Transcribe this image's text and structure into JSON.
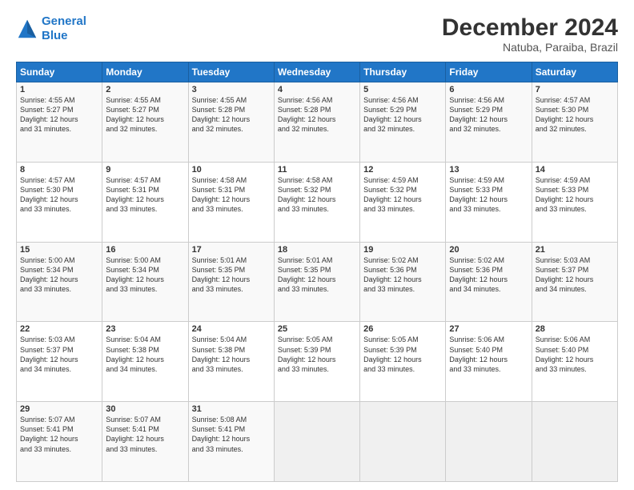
{
  "logo": {
    "line1": "General",
    "line2": "Blue"
  },
  "title": "December 2024",
  "location": "Natuba, Paraiba, Brazil",
  "columns": [
    "Sunday",
    "Monday",
    "Tuesday",
    "Wednesday",
    "Thursday",
    "Friday",
    "Saturday"
  ],
  "weeks": [
    [
      {
        "day": "1",
        "info": "Sunrise: 4:55 AM\nSunset: 5:27 PM\nDaylight: 12 hours\nand 31 minutes."
      },
      {
        "day": "2",
        "info": "Sunrise: 4:55 AM\nSunset: 5:27 PM\nDaylight: 12 hours\nand 32 minutes."
      },
      {
        "day": "3",
        "info": "Sunrise: 4:55 AM\nSunset: 5:28 PM\nDaylight: 12 hours\nand 32 minutes."
      },
      {
        "day": "4",
        "info": "Sunrise: 4:56 AM\nSunset: 5:28 PM\nDaylight: 12 hours\nand 32 minutes."
      },
      {
        "day": "5",
        "info": "Sunrise: 4:56 AM\nSunset: 5:29 PM\nDaylight: 12 hours\nand 32 minutes."
      },
      {
        "day": "6",
        "info": "Sunrise: 4:56 AM\nSunset: 5:29 PM\nDaylight: 12 hours\nand 32 minutes."
      },
      {
        "day": "7",
        "info": "Sunrise: 4:57 AM\nSunset: 5:30 PM\nDaylight: 12 hours\nand 32 minutes."
      }
    ],
    [
      {
        "day": "8",
        "info": "Sunrise: 4:57 AM\nSunset: 5:30 PM\nDaylight: 12 hours\nand 33 minutes."
      },
      {
        "day": "9",
        "info": "Sunrise: 4:57 AM\nSunset: 5:31 PM\nDaylight: 12 hours\nand 33 minutes."
      },
      {
        "day": "10",
        "info": "Sunrise: 4:58 AM\nSunset: 5:31 PM\nDaylight: 12 hours\nand 33 minutes."
      },
      {
        "day": "11",
        "info": "Sunrise: 4:58 AM\nSunset: 5:32 PM\nDaylight: 12 hours\nand 33 minutes."
      },
      {
        "day": "12",
        "info": "Sunrise: 4:59 AM\nSunset: 5:32 PM\nDaylight: 12 hours\nand 33 minutes."
      },
      {
        "day": "13",
        "info": "Sunrise: 4:59 AM\nSunset: 5:33 PM\nDaylight: 12 hours\nand 33 minutes."
      },
      {
        "day": "14",
        "info": "Sunrise: 4:59 AM\nSunset: 5:33 PM\nDaylight: 12 hours\nand 33 minutes."
      }
    ],
    [
      {
        "day": "15",
        "info": "Sunrise: 5:00 AM\nSunset: 5:34 PM\nDaylight: 12 hours\nand 33 minutes."
      },
      {
        "day": "16",
        "info": "Sunrise: 5:00 AM\nSunset: 5:34 PM\nDaylight: 12 hours\nand 33 minutes."
      },
      {
        "day": "17",
        "info": "Sunrise: 5:01 AM\nSunset: 5:35 PM\nDaylight: 12 hours\nand 33 minutes."
      },
      {
        "day": "18",
        "info": "Sunrise: 5:01 AM\nSunset: 5:35 PM\nDaylight: 12 hours\nand 33 minutes."
      },
      {
        "day": "19",
        "info": "Sunrise: 5:02 AM\nSunset: 5:36 PM\nDaylight: 12 hours\nand 33 minutes."
      },
      {
        "day": "20",
        "info": "Sunrise: 5:02 AM\nSunset: 5:36 PM\nDaylight: 12 hours\nand 34 minutes."
      },
      {
        "day": "21",
        "info": "Sunrise: 5:03 AM\nSunset: 5:37 PM\nDaylight: 12 hours\nand 34 minutes."
      }
    ],
    [
      {
        "day": "22",
        "info": "Sunrise: 5:03 AM\nSunset: 5:37 PM\nDaylight: 12 hours\nand 34 minutes."
      },
      {
        "day": "23",
        "info": "Sunrise: 5:04 AM\nSunset: 5:38 PM\nDaylight: 12 hours\nand 34 minutes."
      },
      {
        "day": "24",
        "info": "Sunrise: 5:04 AM\nSunset: 5:38 PM\nDaylight: 12 hours\nand 33 minutes."
      },
      {
        "day": "25",
        "info": "Sunrise: 5:05 AM\nSunset: 5:39 PM\nDaylight: 12 hours\nand 33 minutes."
      },
      {
        "day": "26",
        "info": "Sunrise: 5:05 AM\nSunset: 5:39 PM\nDaylight: 12 hours\nand 33 minutes."
      },
      {
        "day": "27",
        "info": "Sunrise: 5:06 AM\nSunset: 5:40 PM\nDaylight: 12 hours\nand 33 minutes."
      },
      {
        "day": "28",
        "info": "Sunrise: 5:06 AM\nSunset: 5:40 PM\nDaylight: 12 hours\nand 33 minutes."
      }
    ],
    [
      {
        "day": "29",
        "info": "Sunrise: 5:07 AM\nSunset: 5:41 PM\nDaylight: 12 hours\nand 33 minutes."
      },
      {
        "day": "30",
        "info": "Sunrise: 5:07 AM\nSunset: 5:41 PM\nDaylight: 12 hours\nand 33 minutes."
      },
      {
        "day": "31",
        "info": "Sunrise: 5:08 AM\nSunset: 5:41 PM\nDaylight: 12 hours\nand 33 minutes."
      },
      null,
      null,
      null,
      null
    ]
  ]
}
